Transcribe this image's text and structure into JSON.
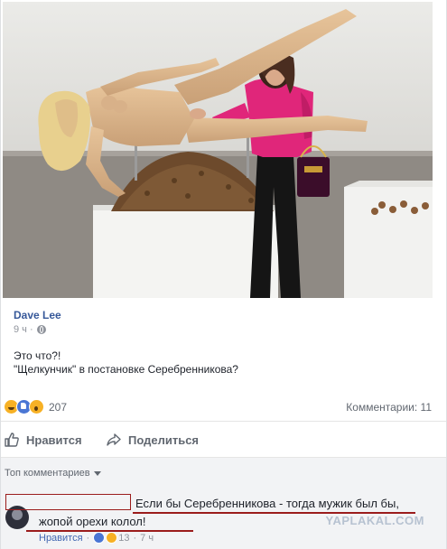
{
  "post": {
    "author": "Dave Lee",
    "time": "9 ч · ",
    "text_line1": "Это что?!",
    "text_line2": "\"Щелкунчик\" в постановке Серебренникова?"
  },
  "reactions": {
    "icons": [
      "haha",
      "like",
      "wow"
    ],
    "count": "207",
    "comments_label": "Комментарии: 11"
  },
  "actions": {
    "like_label": "Нравится",
    "share_label": "Поделиться"
  },
  "comments": {
    "sort_label": "Топ комментариев",
    "items": [
      {
        "text_line1": "Если бы Серебренникова - тогда мужик был бы,",
        "text_line2": "жопой орехи колол!",
        "like_label": "Нравится",
        "meta_sep": " · ",
        "reaction_count": "13",
        "time": "7 ч"
      }
    ]
  },
  "watermark": "YAPLAKAL.COM",
  "colors": {
    "link": "#365899",
    "muted": "#616770",
    "coat": "#e0267a",
    "redaction": "#9b1c1c"
  }
}
